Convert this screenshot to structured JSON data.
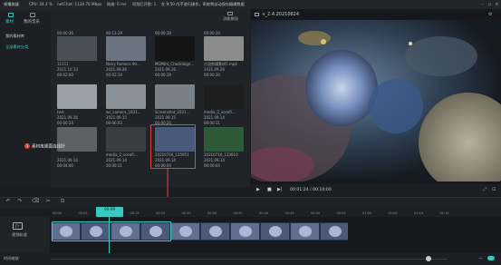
{
  "titlebar": {
    "app_title": "帧播放器",
    "cpu": "CPU: 24.3 %",
    "net": "netChat: 1134.70 Mbps",
    "net2": "网络: 6 ms",
    "sync": "同频打开数: 1",
    "autosave": "在 9:50 内不进行操作，系统将自动保存编辑数据"
  },
  "side_tabs": [
    {
      "label": "素材"
    },
    {
      "label": "我的音乐"
    }
  ],
  "library": {
    "tabs": [
      "我的素材库",
      "全部素材分类"
    ]
  },
  "top_right_tab": "功能按钮",
  "media_grid": [
    {
      "date_top": "00:00:36",
      "name": "11111",
      "date": "2021.10.13",
      "duration": "00:02:00",
      "color": "#4a5058"
    },
    {
      "date_top": "00:13.29",
      "name": "Nicky Romero /Kr...",
      "date": "2021.09.26",
      "duration": "00:02:14",
      "color": "#6b7480"
    },
    {
      "date_top": "00:00:19",
      "name": "MGMInt_Checklaign...",
      "date": "2021.09.26",
      "duration": "00:00:19",
      "color": "#141414"
    },
    {
      "date_top": "00:00:30",
      "name": "片段剪辑素材5.mp4",
      "date": "2021.09.26",
      "duration": "00:00:30",
      "color": "#8c8c8c"
    },
    {
      "date_top": "",
      "name": "test",
      "date": "2021.09.26",
      "duration": "00:00:24",
      "color": "#9aa0a7"
    },
    {
      "date_top": "",
      "name": "ws_camera_1631...",
      "date": "2021.09.15",
      "duration": "00:00:03",
      "color": "#8a9097"
    },
    {
      "date_top": "",
      "name": "Screenshot_2021...",
      "date": "2021.09.15",
      "duration": "00:00:24",
      "color": "#7a8088"
    },
    {
      "date_top": "",
      "name": "media_2_scenfi...",
      "date": "2021.09.14",
      "duration": "00:00:11",
      "color": "#1e1e1e"
    },
    {
      "date_top": "",
      "name": "",
      "date": "2021.09.14",
      "duration": "00:04:00",
      "color": "#5c6168"
    },
    {
      "date_top": "",
      "name": "media_2_scenfi...",
      "date": "2021.09.14",
      "duration": "00:00:11",
      "color": "#3a3e44"
    },
    {
      "date_top": "",
      "name": "20210716_135951",
      "date": "2021.09.14",
      "duration": "00:00:04",
      "color": "#4a5a7a"
    },
    {
      "date_top": "",
      "name": "20210716_133910",
      "date": "2021.09.14",
      "duration": "00:00:04",
      "color": "#2f5a3a"
    }
  ],
  "callouts": {
    "one_num": "1",
    "one_text": "素材库里面选择好",
    "two_num": "2",
    "two_text": "将视频拖入编辑操作区"
  },
  "preview": {
    "title": "v_2.4.20210624",
    "current_time": "00:01:24",
    "total_time": "00:10:00",
    "separator": "/"
  },
  "timeline": {
    "marker_label": "00:09",
    "track_label": "视频轨道",
    "bottom_label": "时间缩放",
    "ticks": [
      "00:00",
      "00:05",
      "00:10",
      "00:15",
      "00:20",
      "00:25",
      "00:30",
      "00:35",
      "00:40",
      "00:45",
      "00:50",
      "00:55",
      "01:00",
      "01:05",
      "01:10",
      "01:15"
    ]
  },
  "colors": {
    "accent": "#3ac8c0",
    "callout_red": "#e0463c",
    "highlight_box": "#e0463c"
  }
}
